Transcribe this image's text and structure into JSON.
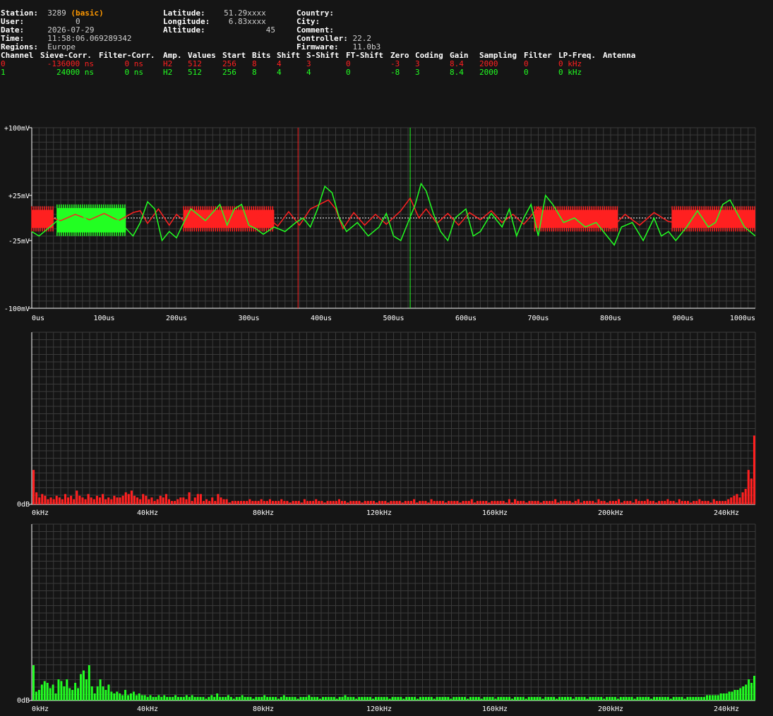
{
  "station": {
    "station_label": "Station:",
    "station_value": "3289",
    "station_badge": "(basic)",
    "user_label": "User:",
    "user_value": "0",
    "date_label": "Date:",
    "date_value": "2026-07-29",
    "time_label": "Time:",
    "time_value": "11:58:06.069289342",
    "regions_label": "Regions:",
    "regions_value": "Europe"
  },
  "location": {
    "lat_label": "Latitude:",
    "lat_value": "51.29xxxx",
    "lon_label": "Longitude:",
    "lon_value": "6.83xxxx",
    "alt_label": "Altitude:",
    "alt_value": "45"
  },
  "meta": {
    "country_label": "Country:",
    "country_value": "",
    "city_label": "City:",
    "city_value": "",
    "comment_label": "Comment:",
    "comment_value": "",
    "controller_label": "Controller:",
    "controller_value": "22.2",
    "firmware_label": "Firmware:",
    "firmware_value": "11.0b3"
  },
  "channel_table": {
    "headers": [
      "Channel",
      "Sieve-Corr.",
      "Filter-Corr.",
      "Amp.",
      "Values",
      "Start",
      "Bits",
      "Shift",
      "S-Shift",
      "FT-Shift",
      "Zero",
      "Coding",
      "Gain",
      "Sampling",
      "Filter",
      "LP-Freq.",
      "Antenna"
    ],
    "rows": [
      {
        "color": "#ff2020",
        "cells": [
          "0",
          "-136000 ns",
          "0 ns",
          "H2",
          "512",
          "256",
          "8",
          "4",
          "3",
          "0",
          "-3",
          "3",
          "8.4",
          "2000",
          "0",
          "0 kHz",
          ""
        ]
      },
      {
        "color": "#22ff22",
        "cells": [
          "1",
          "24000 ns",
          "0 ns",
          "H2",
          "512",
          "256",
          "8",
          "4",
          "4",
          "0",
          "-8",
          "3",
          "8.4",
          "2000",
          "0",
          "0 kHz",
          ""
        ]
      }
    ]
  },
  "colors": {
    "ch0": "#ff2020",
    "ch1": "#22ff22",
    "background": "#151515",
    "grid": "#3a3a3a"
  },
  "chart_data": [
    {
      "type": "line",
      "y_tick_labels": [
        "+100mV",
        "+25mV",
        "-25mV",
        "-100mV"
      ],
      "x_tick_labels": [
        "0us",
        "100us",
        "200us",
        "300us",
        "400us",
        "500us",
        "600us",
        "700us",
        "800us",
        "900us",
        "1000us"
      ],
      "xlim": [
        0,
        1000
      ],
      "ylim": [
        -100,
        100
      ],
      "markers": [
        {
          "x": 368,
          "series": "0"
        },
        {
          "x": 523,
          "series": "1"
        }
      ],
      "series": [
        {
          "name": "0",
          "color": "#ff2020",
          "points": [
            [
              0,
              -5
            ],
            [
              20,
              2
            ],
            [
              40,
              -3
            ],
            [
              60,
              4
            ],
            [
              80,
              -2
            ],
            [
              100,
              5
            ],
            [
              120,
              -3
            ],
            [
              140,
              6
            ],
            [
              150,
              8
            ],
            [
              160,
              -6
            ],
            [
              175,
              10
            ],
            [
              190,
              -8
            ],
            [
              200,
              4
            ],
            [
              220,
              -10
            ],
            [
              240,
              6
            ],
            [
              260,
              -5
            ],
            [
              280,
              8
            ],
            [
              300,
              -6
            ],
            [
              320,
              5
            ],
            [
              340,
              -9
            ],
            [
              355,
              7
            ],
            [
              370,
              -8
            ],
            [
              385,
              10
            ],
            [
              400,
              16
            ],
            [
              410,
              20
            ],
            [
              420,
              10
            ],
            [
              430,
              -12
            ],
            [
              445,
              6
            ],
            [
              460,
              -8
            ],
            [
              475,
              4
            ],
            [
              490,
              -7
            ],
            [
              510,
              8
            ],
            [
              523,
              22
            ],
            [
              535,
              0
            ],
            [
              545,
              10
            ],
            [
              560,
              -6
            ],
            [
              575,
              5
            ],
            [
              590,
              -8
            ],
            [
              605,
              6
            ],
            [
              620,
              -2
            ],
            [
              635,
              8
            ],
            [
              650,
              -5
            ],
            [
              665,
              4
            ],
            [
              680,
              -7
            ],
            [
              700,
              12
            ],
            [
              720,
              -4
            ],
            [
              740,
              6
            ],
            [
              760,
              -10
            ],
            [
              780,
              8
            ],
            [
              800,
              -12
            ],
            [
              820,
              4
            ],
            [
              840,
              -8
            ],
            [
              860,
              6
            ],
            [
              880,
              -4
            ],
            [
              900,
              -6
            ],
            [
              920,
              8
            ],
            [
              940,
              -3
            ],
            [
              960,
              6
            ],
            [
              980,
              -5
            ],
            [
              1000,
              -8
            ]
          ]
        },
        {
          "name": "1",
          "color": "#22ff22",
          "points": [
            [
              0,
              -15
            ],
            [
              10,
              -20
            ],
            [
              25,
              -10
            ],
            [
              40,
              0
            ],
            [
              60,
              10
            ],
            [
              80,
              -5
            ],
            [
              100,
              0
            ],
            [
              120,
              -3
            ],
            [
              140,
              -20
            ],
            [
              150,
              -5
            ],
            [
              160,
              18
            ],
            [
              170,
              10
            ],
            [
              180,
              -25
            ],
            [
              190,
              -15
            ],
            [
              200,
              -22
            ],
            [
              210,
              -5
            ],
            [
              220,
              10
            ],
            [
              240,
              -3
            ],
            [
              260,
              15
            ],
            [
              270,
              -8
            ],
            [
              280,
              10
            ],
            [
              290,
              15
            ],
            [
              300,
              -8
            ],
            [
              310,
              -12
            ],
            [
              320,
              -18
            ],
            [
              335,
              -10
            ],
            [
              350,
              -15
            ],
            [
              365,
              -5
            ],
            [
              375,
              0
            ],
            [
              385,
              -10
            ],
            [
              395,
              10
            ],
            [
              405,
              35
            ],
            [
              415,
              28
            ],
            [
              425,
              0
            ],
            [
              435,
              -15
            ],
            [
              450,
              -5
            ],
            [
              465,
              -20
            ],
            [
              480,
              -10
            ],
            [
              490,
              5
            ],
            [
              500,
              -20
            ],
            [
              510,
              -25
            ],
            [
              520,
              -5
            ],
            [
              530,
              15
            ],
            [
              538,
              38
            ],
            [
              545,
              30
            ],
            [
              555,
              5
            ],
            [
              565,
              -15
            ],
            [
              575,
              -25
            ],
            [
              585,
              0
            ],
            [
              600,
              10
            ],
            [
              610,
              -20
            ],
            [
              620,
              -15
            ],
            [
              635,
              5
            ],
            [
              650,
              -10
            ],
            [
              660,
              10
            ],
            [
              670,
              -20
            ],
            [
              680,
              0
            ],
            [
              690,
              15
            ],
            [
              700,
              -20
            ],
            [
              710,
              25
            ],
            [
              720,
              15
            ],
            [
              735,
              -5
            ],
            [
              750,
              0
            ],
            [
              765,
              -10
            ],
            [
              780,
              -5
            ],
            [
              795,
              -20
            ],
            [
              805,
              -30
            ],
            [
              815,
              -10
            ],
            [
              830,
              -5
            ],
            [
              845,
              -25
            ],
            [
              860,
              0
            ],
            [
              870,
              -20
            ],
            [
              880,
              -15
            ],
            [
              890,
              -25
            ],
            [
              905,
              -10
            ],
            [
              920,
              8
            ],
            [
              935,
              -10
            ],
            [
              945,
              -5
            ],
            [
              955,
              15
            ],
            [
              965,
              20
            ],
            [
              975,
              5
            ],
            [
              985,
              -10
            ],
            [
              1000,
              -20
            ]
          ]
        }
      ]
    },
    {
      "type": "bar",
      "series_name": "0",
      "color": "#ff2020",
      "y_tick_labels": [
        "0dB"
      ],
      "x_tick_labels": [
        "0kHz",
        "40kHz",
        "80kHz",
        "120kHz",
        "160kHz",
        "200kHz",
        "240kHz"
      ],
      "xlim": [
        0,
        250
      ],
      "values": [
        20,
        7,
        4,
        6,
        5,
        3,
        4,
        3,
        5,
        4,
        3,
        6,
        4,
        5,
        3,
        8,
        5,
        4,
        3,
        6,
        4,
        3,
        5,
        4,
        6,
        3,
        4,
        3,
        5,
        4,
        4,
        5,
        7,
        6,
        8,
        5,
        4,
        3,
        6,
        5,
        3,
        4,
        2,
        3,
        5,
        4,
        6,
        3,
        2,
        2,
        3,
        4,
        4,
        3,
        7,
        2,
        4,
        6,
        6,
        2,
        3,
        2,
        4,
        2,
        6,
        4,
        3,
        3,
        1,
        2,
        2,
        2,
        2,
        2,
        2,
        3,
        2,
        2,
        2,
        3,
        2,
        2,
        3,
        2,
        2,
        2,
        3,
        2,
        2,
        1,
        2,
        2,
        2,
        1,
        3,
        2,
        2,
        2,
        3,
        2,
        2,
        1,
        2,
        2,
        2,
        2,
        3,
        2,
        2,
        1,
        2,
        2,
        2,
        2,
        1,
        2,
        2,
        2,
        2,
        1,
        2,
        2,
        2,
        1,
        2,
        2,
        2,
        2,
        1,
        2,
        2,
        2,
        3,
        1,
        2,
        2,
        2,
        1,
        3,
        2,
        2,
        2,
        2,
        1,
        2,
        2,
        2,
        2,
        1,
        2,
        2,
        2,
        3,
        1,
        2,
        2,
        2,
        2,
        1,
        2,
        2,
        2,
        2,
        2,
        1,
        3,
        1,
        3,
        2,
        2,
        2,
        1,
        2,
        2,
        2,
        2,
        1,
        2,
        2,
        2,
        2,
        3,
        1,
        2,
        2,
        2,
        2,
        1,
        2,
        3,
        1,
        2,
        2,
        2,
        2,
        1,
        3,
        2,
        2,
        1,
        2,
        2,
        2,
        3,
        1,
        2,
        2,
        2,
        1,
        3,
        2,
        2,
        2,
        3,
        2,
        2,
        1,
        2,
        2,
        2,
        3,
        2,
        2,
        1,
        3,
        2,
        2,
        2,
        1,
        2,
        2,
        3,
        2,
        2,
        2,
        1,
        3,
        2,
        2,
        2,
        2,
        3,
        4,
        5,
        6,
        4,
        7,
        9,
        20,
        15,
        40
      ]
    },
    {
      "type": "bar",
      "series_name": "1",
      "color": "#22ff22",
      "y_tick_labels": [
        "0dB"
      ],
      "x_tick_labels": [
        "0kHz",
        "40kHz",
        "80kHz",
        "120kHz",
        "160kHz",
        "200kHz",
        "240kHz"
      ],
      "xlim": [
        0,
        250
      ],
      "values": [
        20,
        5,
        6,
        9,
        11,
        10,
        7,
        9,
        4,
        12,
        11,
        8,
        12,
        7,
        6,
        10,
        7,
        15,
        17,
        12,
        20,
        8,
        4,
        8,
        12,
        8,
        6,
        9,
        5,
        4,
        5,
        4,
        3,
        6,
        3,
        4,
        5,
        3,
        4,
        3,
        3,
        2,
        3,
        2,
        2,
        3,
        2,
        3,
        2,
        2,
        2,
        3,
        2,
        2,
        2,
        3,
        2,
        3,
        2,
        2,
        2,
        2,
        1,
        2,
        3,
        2,
        4,
        2,
        2,
        2,
        3,
        2,
        1,
        2,
        2,
        3,
        2,
        2,
        2,
        1,
        2,
        2,
        2,
        3,
        2,
        2,
        2,
        2,
        1,
        2,
        3,
        2,
        2,
        2,
        2,
        1,
        2,
        2,
        2,
        3,
        2,
        2,
        2,
        1,
        2,
        2,
        2,
        2,
        2,
        1,
        2,
        2,
        3,
        2,
        2,
        2,
        1,
        2,
        2,
        2,
        2,
        2,
        1,
        2,
        2,
        2,
        2,
        2,
        1,
        2,
        2,
        2,
        2,
        1,
        2,
        2,
        2,
        2,
        1,
        2,
        2,
        2,
        2,
        2,
        1,
        2,
        2,
        2,
        2,
        2,
        1,
        2,
        2,
        2,
        2,
        2,
        1,
        2,
        2,
        2,
        2,
        1,
        2,
        2,
        2,
        2,
        1,
        2,
        2,
        2,
        2,
        2,
        1,
        2,
        2,
        2,
        2,
        1,
        2,
        2,
        2,
        2,
        2,
        1,
        2,
        2,
        2,
        2,
        1,
        2,
        2,
        2,
        2,
        2,
        1,
        2,
        2,
        2,
        2,
        1,
        2,
        2,
        2,
        2,
        2,
        1,
        2,
        2,
        2,
        2,
        1,
        2,
        2,
        2,
        2,
        2,
        1,
        2,
        2,
        2,
        2,
        2,
        1,
        2,
        2,
        2,
        2,
        2,
        2,
        1,
        2,
        2,
        2,
        2,
        1,
        2,
        2,
        2,
        2,
        2,
        2,
        2,
        3,
        3,
        3,
        3,
        3,
        4,
        4,
        4,
        5,
        5,
        6,
        6,
        7,
        8,
        9,
        12,
        10,
        14
      ]
    }
  ]
}
